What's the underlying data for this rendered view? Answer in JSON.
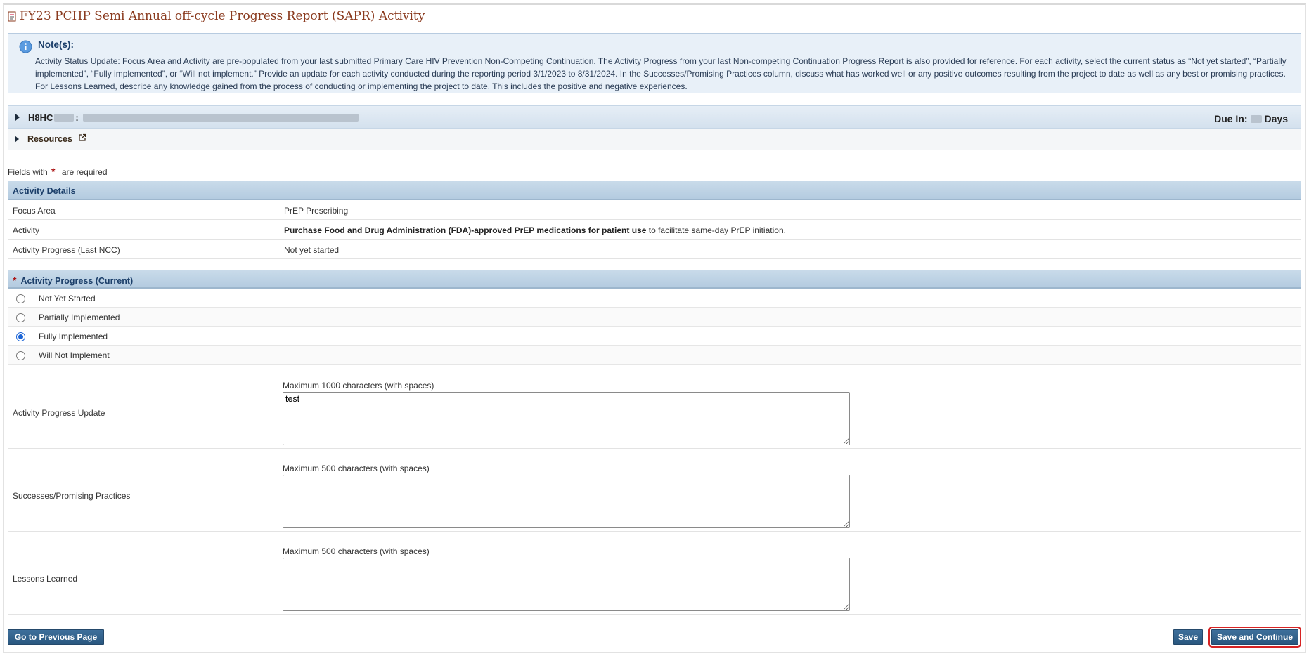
{
  "page": {
    "title": "FY23 PCHP Semi Annual off-cycle Progress Report (SAPR) Activity"
  },
  "note": {
    "title": "Note(s):",
    "text": "Activity Status Update: Focus Area and Activity are pre-populated from your last submitted Primary Care HIV Prevention Non-Competing Continuation. The Activity Progress from your last Non-competing Continuation Progress Report is also provided for reference. For each activity, select the current status as “Not yet started”, “Partially implemented”, “Fully implemented”, or “Will not implement.” Provide an update for each activity conducted during the reporting period 3/1/2023 to 8/31/2024. In the Successes/Promising Practices column, discuss what has worked well or any positive outcomes resulting from the project to date as well as any best or promising practices. For Lessons Learned, describe any knowledge gained from the process of conducting or implementing the project to date. This includes the positive and negative experiences."
  },
  "grant": {
    "id_prefix": "H8HC",
    "separator": ":",
    "due_label": "Due In:",
    "due_unit": "Days"
  },
  "resources": {
    "label": "Resources"
  },
  "required_note": {
    "prefix": "Fields with",
    "star": "*",
    "suffix": "are required"
  },
  "activity_details": {
    "heading": "Activity Details",
    "rows": [
      {
        "label": "Focus Area",
        "value": "PrEP Prescribing"
      },
      {
        "label": "Activity",
        "value_bold": "Purchase Food and Drug Administration (FDA)-approved PrEP medications for patient use",
        "value_rest": " to facilitate same-day PrEP initiation."
      },
      {
        "label": "Activity Progress (Last NCC)",
        "value": "Not yet started"
      }
    ]
  },
  "activity_progress": {
    "heading": "Activity Progress (Current)",
    "star": "*",
    "options": [
      {
        "label": "Not Yet Started",
        "checked": false
      },
      {
        "label": "Partially Implemented",
        "checked": false
      },
      {
        "label": "Fully Implemented",
        "checked": true
      },
      {
        "label": "Will Not Implement",
        "checked": false
      }
    ]
  },
  "fields": {
    "progress_update": {
      "label": "Activity Progress Update",
      "hint": "Maximum 1000 characters (with spaces)",
      "value": "test"
    },
    "successes": {
      "label": "Successes/Promising Practices",
      "hint": "Maximum 500 characters (with spaces)",
      "value": ""
    },
    "lessons": {
      "label": "Lessons Learned",
      "hint": "Maximum 500 characters (with spaces)",
      "value": ""
    }
  },
  "buttons": {
    "previous": "Go to Previous Page",
    "save": "Save",
    "save_continue": "Save and Continue"
  },
  "icons": {
    "title": "document-icon",
    "note": "info-icon",
    "resources": "external-link-icon"
  },
  "colors": {
    "title": "#8a3a1e",
    "button": "#2f5f8a",
    "highlight": "#d62323",
    "radio_checked": "#1b64d6"
  }
}
